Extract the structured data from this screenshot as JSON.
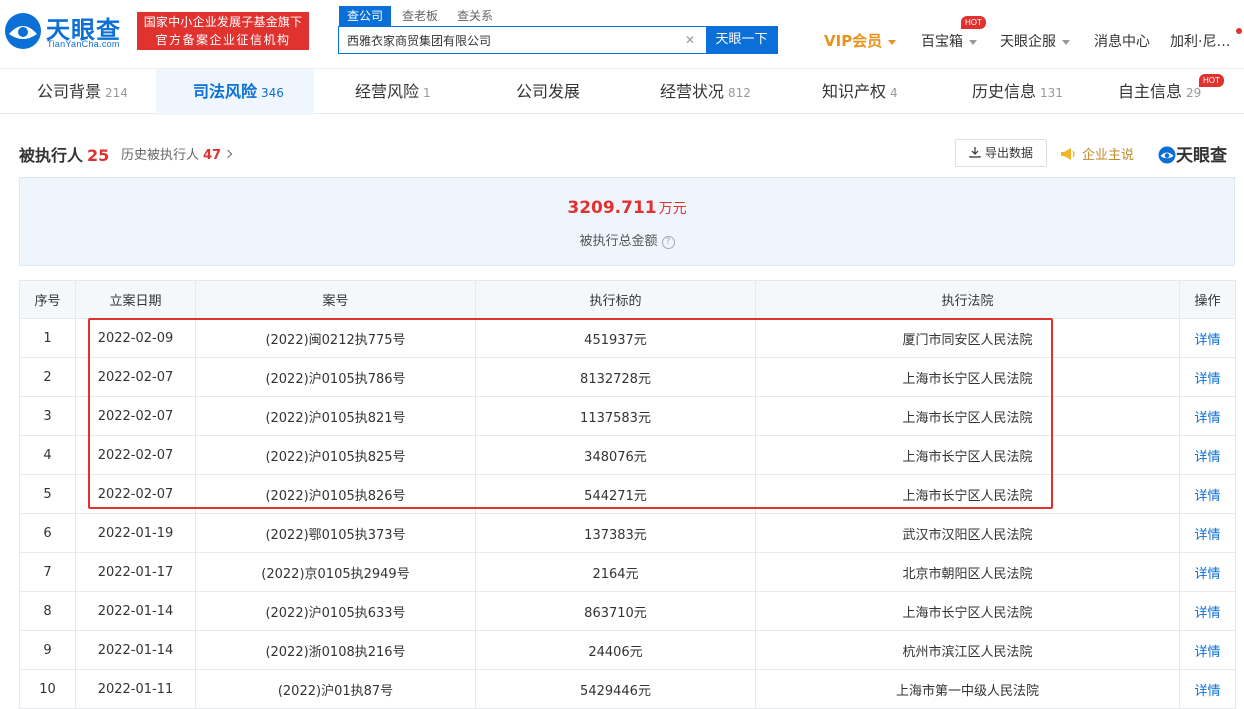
{
  "header": {
    "logo_text": "天眼查",
    "logo_sub": "TianYanCha.com",
    "fund_badge_line1": "国家中小企业发展子基金旗下",
    "fund_badge_line2": "官方备案企业征信机构",
    "search_tabs": [
      "查公司",
      "查老板",
      "查关系"
    ],
    "search_value": "西雅衣家商贸集团有限公司",
    "search_button": "天眼一下",
    "vip_label": "VIP会员",
    "baibaoxiang": "百宝箱",
    "hot_label": "HOT",
    "qifu": "天眼企服",
    "messages": "消息中心",
    "user": "加利·尼…"
  },
  "tabs": [
    {
      "label": "公司背景",
      "count": "214"
    },
    {
      "label": "司法风险",
      "count": "346"
    },
    {
      "label": "经营风险",
      "count": "1"
    },
    {
      "label": "公司发展",
      "count": ""
    },
    {
      "label": "经营状况",
      "count": "812"
    },
    {
      "label": "知识产权",
      "count": "4"
    },
    {
      "label": "历史信息",
      "count": "131"
    },
    {
      "label": "自主信息",
      "count": "29"
    }
  ],
  "section": {
    "title": "被执行人",
    "count": "25",
    "history_label": "历史被执行人",
    "history_count": "47",
    "export_label": "导出数据",
    "promo_label": "企业主说",
    "brand_label": "天眼查"
  },
  "summary": {
    "amount": "3209.711",
    "unit": "万元",
    "label": "被执行总金额",
    "help": "?"
  },
  "table": {
    "headers": [
      "序号",
      "立案日期",
      "案号",
      "执行标的",
      "执行法院",
      "操作"
    ],
    "rows": [
      [
        "1",
        "2022-02-09",
        "(2022)闽0212执775号",
        "451937元",
        "厦门市同安区人民法院",
        "详情"
      ],
      [
        "2",
        "2022-02-07",
        "(2022)沪0105执786号",
        "8132728元",
        "上海市长宁区人民法院",
        "详情"
      ],
      [
        "3",
        "2022-02-07",
        "(2022)沪0105执821号",
        "1137583元",
        "上海市长宁区人民法院",
        "详情"
      ],
      [
        "4",
        "2022-02-07",
        "(2022)沪0105执825号",
        "348076元",
        "上海市长宁区人民法院",
        "详情"
      ],
      [
        "5",
        "2022-02-07",
        "(2022)沪0105执826号",
        "544271元",
        "上海市长宁区人民法院",
        "详情"
      ],
      [
        "6",
        "2022-01-19",
        "(2022)鄂0105执373号",
        "137383元",
        "武汉市汉阳区人民法院",
        "详情"
      ],
      [
        "7",
        "2022-01-17",
        "(2022)京0105执2949号",
        "2164元",
        "北京市朝阳区人民法院",
        "详情"
      ],
      [
        "8",
        "2022-01-14",
        "(2022)沪0105执633号",
        "863710元",
        "上海市长宁区人民法院",
        "详情"
      ],
      [
        "9",
        "2022-01-14",
        "(2022)浙0108执216号",
        "24406元",
        "杭州市滨江区人民法院",
        "详情"
      ],
      [
        "10",
        "2022-01-11",
        "(2022)沪01执87号",
        "5429446元",
        "上海市第一中级人民法院",
        "详情"
      ]
    ]
  },
  "colors": {
    "accent": "#0a6fd6",
    "red": "#e0322f",
    "vip": "#e8931e"
  }
}
